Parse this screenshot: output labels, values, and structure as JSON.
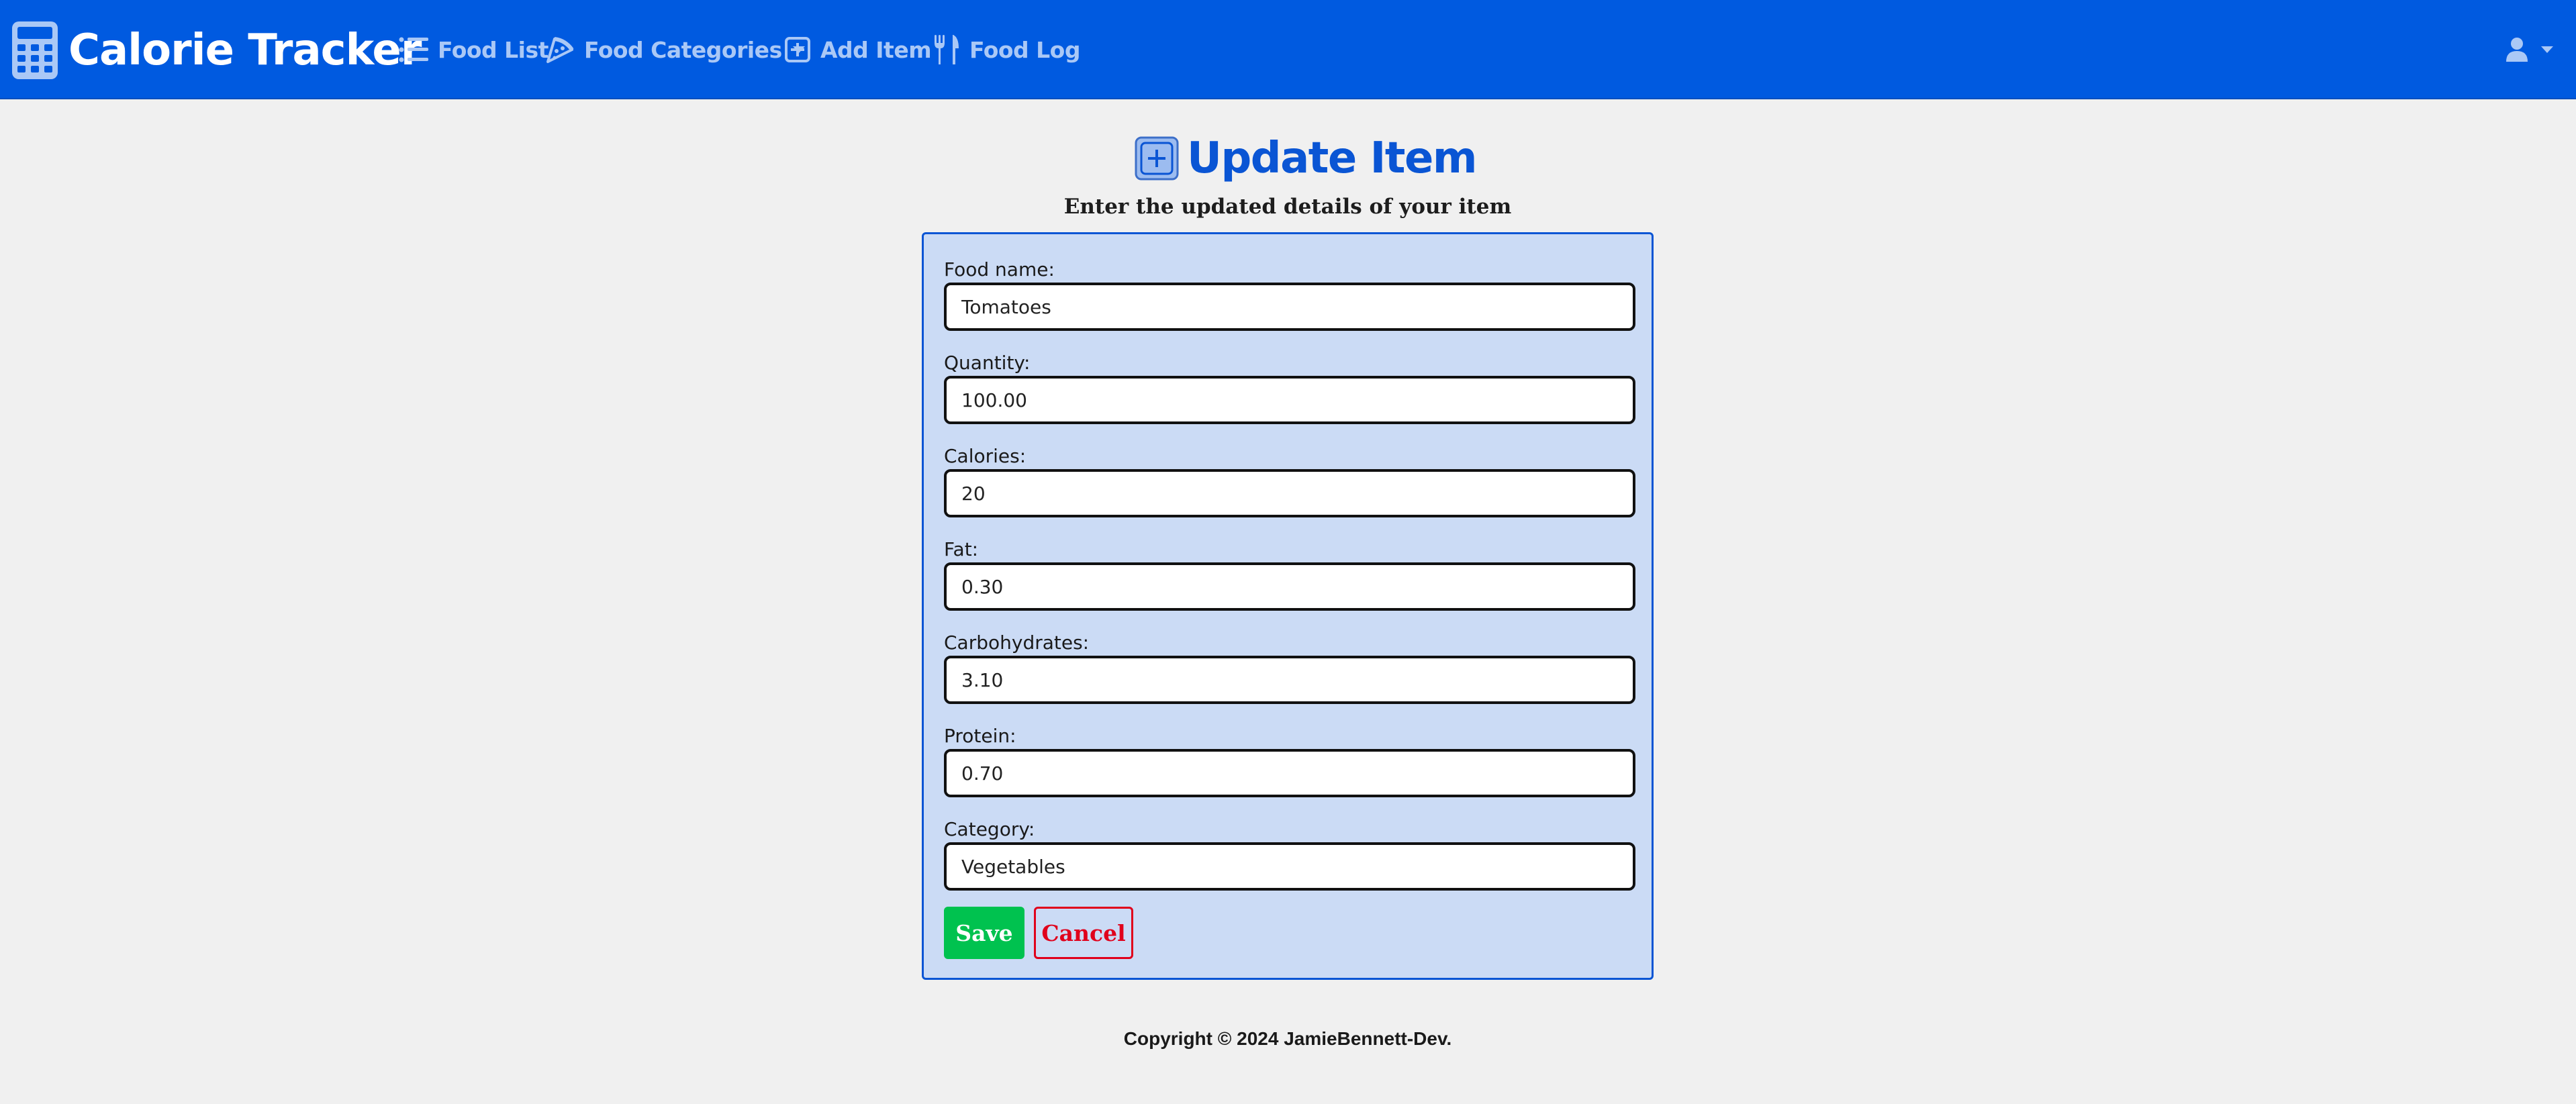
{
  "navbar": {
    "brand": "Calorie Tracker",
    "brand_icon": "calculator-icon",
    "links": [
      {
        "label": "Food List",
        "icon": "list-icon"
      },
      {
        "label": "Food Categories",
        "icon": "pizza-icon",
        "has_dropdown": true
      },
      {
        "label": "Add Item",
        "icon": "plus-square-icon"
      },
      {
        "label": "Food Log",
        "icon": "utensils-icon"
      }
    ],
    "user_icon": "user-icon"
  },
  "header": {
    "title": "Update Item",
    "title_icon": "plus-square-icon",
    "subtitle": "Enter the updated details of your item"
  },
  "form": {
    "fields": [
      {
        "label": "Food name:",
        "value": "Tomatoes"
      },
      {
        "label": "Quantity:",
        "value": "100.00"
      },
      {
        "label": "Calories:",
        "value": "20"
      },
      {
        "label": "Fat:",
        "value": "0.30"
      },
      {
        "label": "Carbohydrates:",
        "value": "3.10"
      },
      {
        "label": "Protein:",
        "value": "0.70"
      },
      {
        "label": "Category:",
        "value": "Vegetables"
      }
    ],
    "save_label": "Save",
    "cancel_label": "Cancel"
  },
  "footer": {
    "copyright": "Copyright © 2024 JamieBennett-Dev."
  },
  "colors": {
    "navbar": "#005ae0",
    "nav_link": "#aac8f6",
    "title": "#0a55d4",
    "card_bg": "#cbdbf5",
    "save": "#00c24f",
    "cancel": "#e0001b"
  }
}
